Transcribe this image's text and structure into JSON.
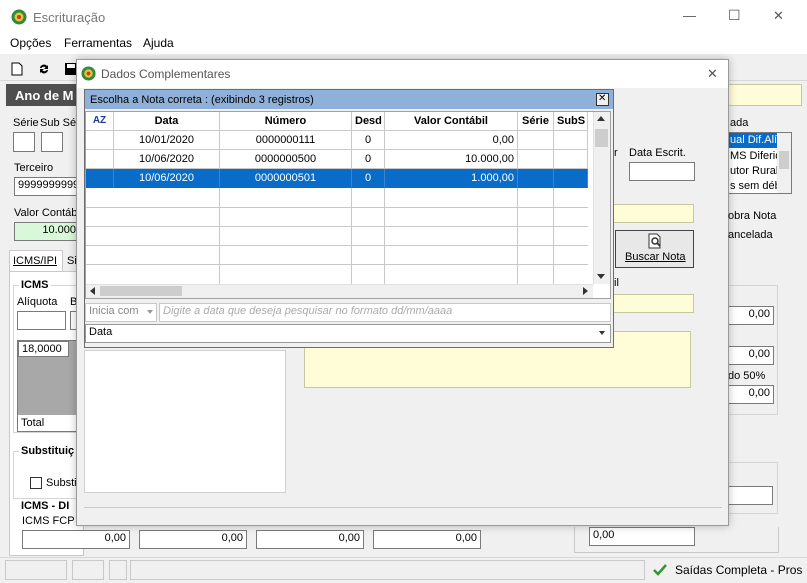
{
  "window": {
    "title": "Escrituração",
    "minimize": "—",
    "maximize": "☐",
    "close": "✕"
  },
  "menu": [
    "Opções",
    "Ferramentas",
    "Ajuda"
  ],
  "header": {
    "ano": "Ano de M"
  },
  "main": {
    "serie_label": "Série",
    "sub_label": "Sub Sér",
    "terceiro_label": "Terceiro",
    "terceiro_value": "9999999999",
    "valor_contabil_label": "Valor Contáb",
    "valor_contabil_value": "10.000",
    "tab_icms": "ICMS/IPI",
    "tab_si": "Si",
    "icms_group": "ICMS",
    "aliquota_label": "Alíquota",
    "b_label": "B",
    "aliquota_value": "18,0000",
    "total_label": "Total",
    "substituicao_group": "Substituiç",
    "substit_checkbox": "Substi",
    "icms_di_group": "ICMS - DI",
    "icms_fcp_label": "ICMS FCP U",
    "bottom_values": [
      "0,00",
      "0,00",
      "0,00",
      "0,00"
    ],
    "right_label": "ada",
    "list_items": [
      "ual Dif.Alíq",
      "MS Diferido",
      "utor Rural",
      "s sem débi"
    ],
    "data_escrit_label": "Data Escrit.",
    "r_label": "r",
    "dobra_nota": "obra Nota",
    "cancelada": "ancelada",
    "il_label": "il",
    "do50_label": "do 50%",
    "right_values": [
      "0,00",
      "0,00",
      "0,00",
      "0,00"
    ],
    "status_text": "Saídas Completa - Pros"
  },
  "dialog": {
    "title": "Dados Complementares",
    "close": "✕",
    "buscar_nota": "Buscar Nota"
  },
  "popup": {
    "title": "Escolha a Nota correta : (exibindo 3 registros)",
    "close": "✕",
    "sort_icon_text": "AZ",
    "columns": [
      "Data",
      "Número",
      "Desd",
      "Valor Contábil",
      "Série",
      "SubS"
    ],
    "rows": [
      [
        "10/01/2020",
        "0000000111",
        "0",
        "0,00",
        "",
        ""
      ],
      [
        "10/06/2020",
        "0000000500",
        "0",
        "10.000,00",
        "",
        ""
      ],
      [
        "10/06/2020",
        "0000000501",
        "0",
        "1.000,00",
        "",
        ""
      ]
    ],
    "selected_row": 2,
    "filter_mode": "Inicia com",
    "search_placeholder": "Digite a data que deseja pesquisar no formato dd/mm/aaaa",
    "field_select": "Data"
  }
}
